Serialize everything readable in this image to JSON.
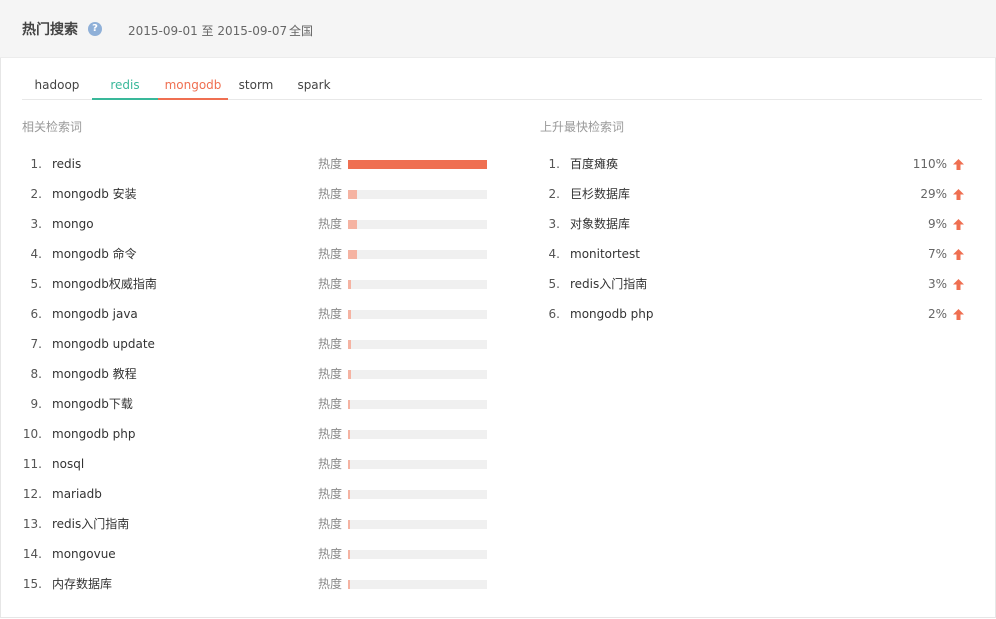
{
  "header": {
    "title": "热门搜索",
    "help_icon": "question-icon",
    "help_glyph": "?",
    "date_range": "2015-09-01 至 2015-09-07",
    "region": "全国"
  },
  "tabs": [
    {
      "label": "hadoop"
    },
    {
      "label": "redis"
    },
    {
      "label": "mongodb"
    },
    {
      "label": "storm"
    },
    {
      "label": "spark"
    }
  ],
  "related": {
    "title": "相关检索词",
    "heat_label": "热度",
    "items": [
      {
        "rank": "1.",
        "term": "redis",
        "heat": 1.0
      },
      {
        "rank": "2.",
        "term": "mongodb 安装",
        "heat": 0.065
      },
      {
        "rank": "3.",
        "term": "mongo",
        "heat": 0.065
      },
      {
        "rank": "4.",
        "term": "mongodb 命令",
        "heat": 0.065
      },
      {
        "rank": "5.",
        "term": "mongodb权威指南",
        "heat": 0.02
      },
      {
        "rank": "6.",
        "term": "mongodb java",
        "heat": 0.02
      },
      {
        "rank": "7.",
        "term": "mongodb update",
        "heat": 0.02
      },
      {
        "rank": "8.",
        "term": "mongodb 教程",
        "heat": 0.02
      },
      {
        "rank": "9.",
        "term": "mongodb下载",
        "heat": 0.01
      },
      {
        "rank": "10.",
        "term": "mongodb php",
        "heat": 0.01
      },
      {
        "rank": "11.",
        "term": "nosql",
        "heat": 0.01
      },
      {
        "rank": "12.",
        "term": "mariadb",
        "heat": 0.01
      },
      {
        "rank": "13.",
        "term": "redis入门指南",
        "heat": 0.01
      },
      {
        "rank": "14.",
        "term": "mongovue",
        "heat": 0.01
      },
      {
        "rank": "15.",
        "term": "内存数据库",
        "heat": 0.01
      }
    ]
  },
  "rising": {
    "title": "上升最快检索词",
    "arrow_icon": "arrow-up-icon",
    "items": [
      {
        "rank": "1.",
        "term": "百度瘫痪",
        "percent": "110%"
      },
      {
        "rank": "2.",
        "term": "巨杉数据库",
        "percent": "29%"
      },
      {
        "rank": "3.",
        "term": "对象数据库",
        "percent": "9%"
      },
      {
        "rank": "4.",
        "term": "monitortest",
        "percent": "7%"
      },
      {
        "rank": "5.",
        "term": "redis入门指南",
        "percent": "3%"
      },
      {
        "rank": "6.",
        "term": "mongodb php",
        "percent": "2%"
      }
    ]
  },
  "colors": {
    "accent_green": "#39b89a",
    "accent_red": "#ef6f51",
    "bar_light": "#f5b3a2",
    "bar_track": "#f0f0f0"
  }
}
